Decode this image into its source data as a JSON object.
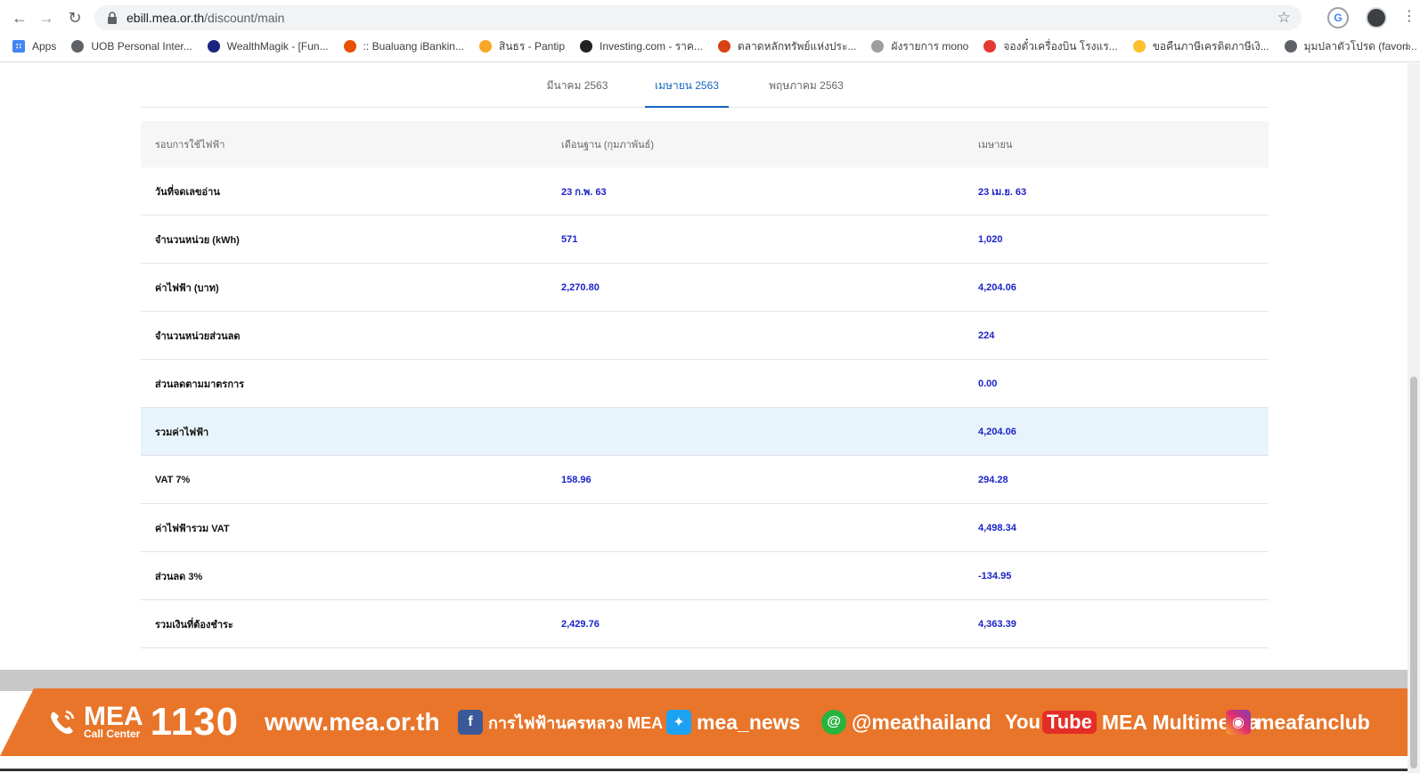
{
  "browser": {
    "url_host": "ebill.mea.or.th",
    "url_path": "/discount/main",
    "bookmarks": [
      {
        "label": "Apps",
        "icon": "apps-grid-icon",
        "color": "#4285f4"
      },
      {
        "label": "UOB Personal Inter...",
        "icon": "globe-icon",
        "color": "#5f6368"
      },
      {
        "label": "WealthMagik - [Fun...",
        "icon": "wealthmagik-icon",
        "color": "#1a237e"
      },
      {
        "label": ":: Bualuang iBankin...",
        "icon": "bualuang-icon",
        "color": "#e65100"
      },
      {
        "label": "สินธร - Pantip",
        "icon": "pantip-icon",
        "color": "#f9a825"
      },
      {
        "label": "Investing.com - ราค...",
        "icon": "investing-icon",
        "color": "#222222"
      },
      {
        "label": "ตลาดหลักทรัพย์แห่งประ...",
        "icon": "set-icon",
        "color": "#d84315"
      },
      {
        "label": "ผังรายการ mono",
        "icon": "mono-icon",
        "color": "#9e9e9e"
      },
      {
        "label": "จองตั๋วเครื่องบิน โรงแร...",
        "icon": "airasia-icon",
        "color": "#e53935"
      },
      {
        "label": "ขอคืนภาษีเครดิตภาษีเงิ...",
        "icon": "tax-icon",
        "color": "#fbc02d"
      },
      {
        "label": "มุมปลาตัวโปรด (favori...",
        "icon": "globe-icon",
        "color": "#5f6368"
      }
    ]
  },
  "tabs": [
    "มีนาคม 2563",
    "เมษายน 2563",
    "พฤษภาคม 2563"
  ],
  "active_tab": 1,
  "table": {
    "headers": [
      "รอบการใช้ไฟฟ้า",
      "เดือนฐาน (กุมภาพันธ์)",
      "เมษายน"
    ],
    "rows": [
      {
        "label": "วันที่จดเลขอ่าน",
        "base": "23 ก.พ. 63",
        "current": "23 เม.ย. 63"
      },
      {
        "label": "จำนวนหน่วย (kWh)",
        "base": "571",
        "current": "1,020"
      },
      {
        "label": "ค่าไฟฟ้า (บาท)",
        "base": "2,270.80",
        "current": "4,204.06"
      },
      {
        "label": "จำนวนหน่วยส่วนลด",
        "base": "",
        "current": "224"
      },
      {
        "label": "ส่วนลดตามมาตรการ",
        "base": "",
        "current": "0.00"
      },
      {
        "label": "รวมค่าไฟฟ้า",
        "base": "",
        "current": "4,204.06"
      },
      {
        "label": "VAT 7%",
        "base": "158.96",
        "current": "294.28"
      },
      {
        "label": "ค่าไฟฟ้ารวม VAT",
        "base": "",
        "current": "4,498.34"
      },
      {
        "label": "ส่วนลด 3%",
        "base": "",
        "current": "-134.95"
      },
      {
        "label": "รวมเงินที่ต้องชำระ",
        "base": "2,429.76",
        "current": "4,363.39"
      }
    ]
  },
  "footer": {
    "mea": "MEA",
    "call_center": "Call Center",
    "call_number": "1130",
    "website": "www.mea.or.th",
    "facebook": "การไฟฟ้านครหลวง MEA",
    "twitter": "mea_news",
    "line": "@meathailand",
    "youtube_you": "You",
    "youtube_tube": "Tube",
    "youtube": "MEA Multimedia",
    "instagram": "meafanclub"
  },
  "colors": {
    "accent": "#1565c0",
    "value_text": "#1a23c8",
    "banner": "#e8752a"
  }
}
